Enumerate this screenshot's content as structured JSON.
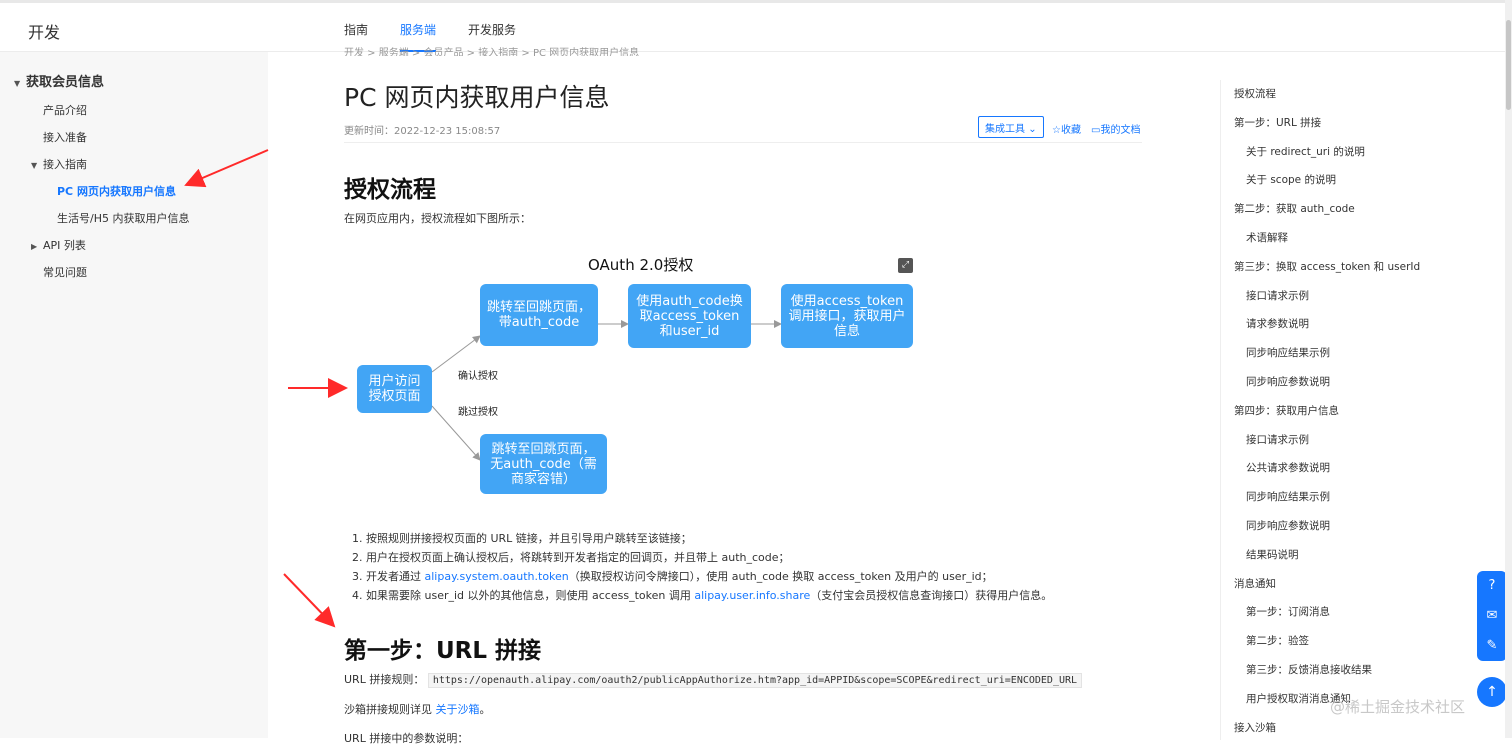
{
  "header": {
    "brand": "开发",
    "tabs": [
      {
        "label": "指南",
        "active": false
      },
      {
        "label": "服务端",
        "active": true
      },
      {
        "label": "开发服务",
        "active": false
      }
    ]
  },
  "sidebar": {
    "group": "获取会员信息",
    "items": [
      {
        "label": "产品介绍"
      },
      {
        "label": "接入准备"
      },
      {
        "label": "接入指南"
      },
      {
        "label": "PC 网页内获取用户信息"
      },
      {
        "label": "生活号/H5 内获取用户信息"
      },
      {
        "label": "API 列表"
      },
      {
        "label": "常见问题"
      }
    ]
  },
  "breadcrumb": "开发 > 服务端 > 会员产品 > 接入指南 > PC 网页内获取用户信息",
  "article": {
    "title": "PC 网页内获取用户信息",
    "updated": "更新时间：2022-12-23 15:08:57",
    "tools_label": "集成工具",
    "favorite_label": "收藏",
    "my_docs_label": "我的文档",
    "section1_title": "授权流程",
    "section1_intro": "在网页应用内，授权流程如下图所示：",
    "flow": {
      "title": "OAuth 2.0授权",
      "node_start": "用户访问授权页面",
      "node_redirect_with": "跳转至回跳页面，带auth_code",
      "node_exchange": "使用auth_code换取access_token和user_id",
      "node_call": "使用access_token调用接口，获取用户信息",
      "node_redirect_without": "跳转至回跳页面，无auth_code（需商家容错）",
      "label_confirm": "确认授权",
      "label_skip": "跳过授权"
    },
    "steps": {
      "s1": "1. 按照规则拼接授权页面的 URL 链接，并且引导用户跳转至该链接；",
      "s2": "2. 用户在授权页面上确认授权后，将跳转到开发者指定的回调页，并且带上 auth_code；",
      "s3_pre": "3. 开发者通过 ",
      "s3_link": "alipay.system.oauth.token",
      "s3_post": "（换取授权访问令牌接口），使用 auth_code 换取 access_token 及用户的 user_id；",
      "s4_pre": "4. 如果需要除 user_id 以外的其他信息，则使用 access_token 调用 ",
      "s4_link": "alipay.user.info.share",
      "s4_post": "（支付宝会员授权信息查询接口）获得用户信息。"
    },
    "section2_title": "第一步：URL 拼接",
    "url_rule_label": "URL 拼接规则：",
    "url_rule_code": "https://openauth.alipay.com/oauth2/publicAppAuthorize.htm?app_id=APPID&scope=SCOPE&redirect_uri=ENCODED_URL",
    "sandbox_pre": "沙箱拼接规则详见 ",
    "sandbox_link": "关于沙箱",
    "sandbox_post": "。",
    "param_desc": "URL 拼接中的参数说明："
  },
  "toc": [
    {
      "label": "授权流程",
      "level": 1
    },
    {
      "label": "第一步：URL 拼接",
      "level": 1
    },
    {
      "label": "关于 redirect_uri 的说明",
      "level": 2
    },
    {
      "label": "关于 scope 的说明",
      "level": 2
    },
    {
      "label": "第二步：获取 auth_code",
      "level": 1
    },
    {
      "label": "术语解释",
      "level": 2
    },
    {
      "label": "第三步：换取 access_token 和 userId",
      "level": 1
    },
    {
      "label": "接口请求示例",
      "level": 2
    },
    {
      "label": "请求参数说明",
      "level": 2
    },
    {
      "label": "同步响应结果示例",
      "level": 2
    },
    {
      "label": "同步响应参数说明",
      "level": 2
    },
    {
      "label": "第四步：获取用户信息",
      "level": 1
    },
    {
      "label": "接口请求示例",
      "level": 2
    },
    {
      "label": "公共请求参数说明",
      "level": 2
    },
    {
      "label": "同步响应结果示例",
      "level": 2
    },
    {
      "label": "同步响应参数说明",
      "level": 2
    },
    {
      "label": "结果码说明",
      "level": 2
    },
    {
      "label": "消息通知",
      "level": 1
    },
    {
      "label": "第一步：订阅消息",
      "level": 2
    },
    {
      "label": "第二步：验签",
      "level": 2
    },
    {
      "label": "第三步：反馈消息接收结果",
      "level": 2
    },
    {
      "label": "用户授权取消消息通知",
      "level": 2
    },
    {
      "label": "接入沙箱",
      "level": 1
    }
  ],
  "watermark": "@稀土掘金技术社区",
  "colors": {
    "accent": "#1677ff",
    "node": "#42a5f5",
    "annotation": "#ff2a2a"
  }
}
